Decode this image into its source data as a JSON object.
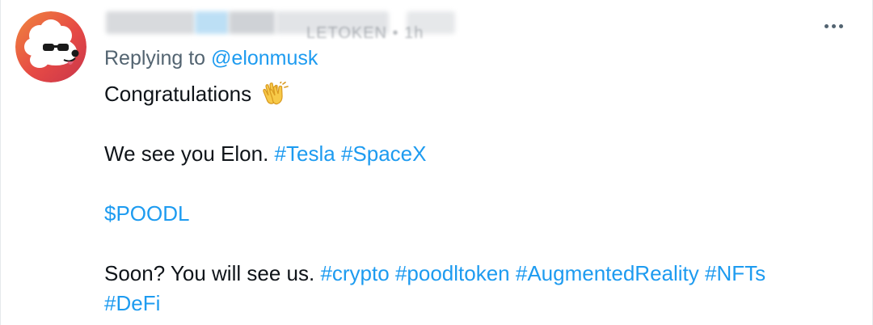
{
  "tweet": {
    "author_redacted": true,
    "header_residue": "LETOKEN  •  1h",
    "reply": {
      "prefix": "Replying to",
      "handle": "@elonmusk"
    },
    "line1": {
      "text": "Congratulations",
      "emoji": "clapping-hands-icon"
    },
    "line2": {
      "text": "We see you Elon.",
      "tags": [
        "#Tesla",
        "#SpaceX"
      ]
    },
    "line3": {
      "cashtag": "$POODL"
    },
    "line4": {
      "text": "Soon? You will see us.",
      "tags": [
        "#crypto",
        "#poodltoken",
        "#AugmentedReality",
        "#NFTs",
        "#DeFi"
      ]
    }
  },
  "icons": {
    "avatar": "poodle-avatar-icon",
    "more": "more-options-icon"
  },
  "colors": {
    "link": "#1d9bf0",
    "text": "#0f1419",
    "muted": "#536471",
    "avatar_bg": "#e74c45"
  }
}
